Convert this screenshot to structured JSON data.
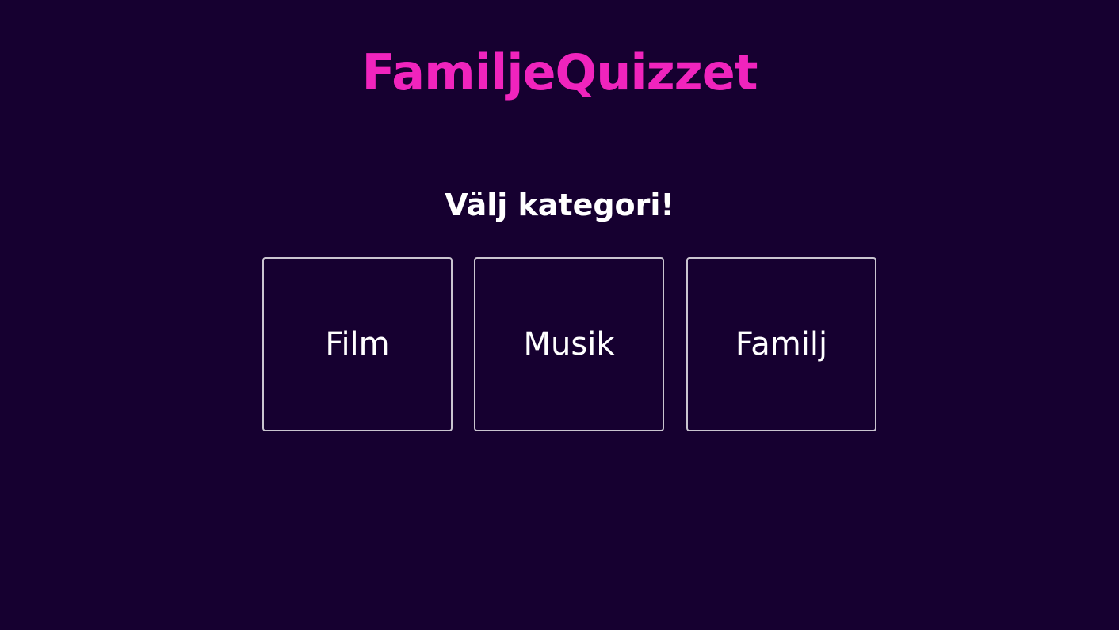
{
  "header": {
    "title": "FamiljeQuizzet"
  },
  "main": {
    "prompt": "Välj kategori!",
    "categories": [
      {
        "label": "Film"
      },
      {
        "label": "Musik"
      },
      {
        "label": "Familj"
      }
    ]
  },
  "colors": {
    "background": "#160030",
    "title": "#f024bd",
    "text": "#ffffff",
    "border": "#c9c4cf"
  }
}
